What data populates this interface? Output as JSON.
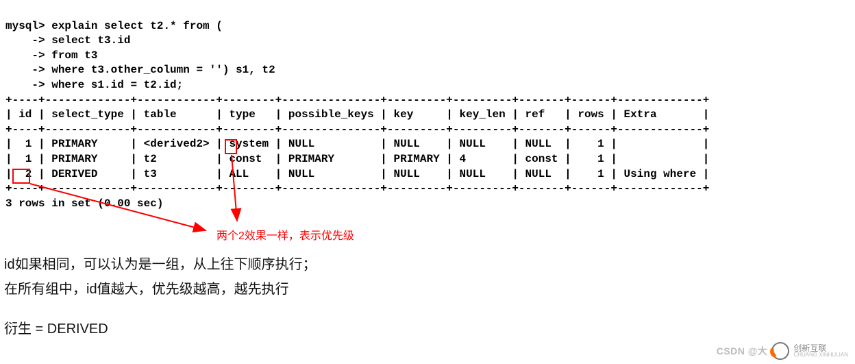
{
  "sql": {
    "prompt": "mysql>",
    "cont": "    ->",
    "lines": [
      "explain select t2.* from (",
      "select t3.id",
      "from t3",
      "where t3.other_column = '') s1, t2",
      "where s1.id = t2.id;"
    ]
  },
  "table": {
    "border": "+----+-------------+------------+--------+---------------+---------+---------+-------+------+-------------+",
    "header": "| id | select_type | table      | type   | possible_keys | key     | key_len | ref   | rows | Extra       |",
    "rows": [
      "|  1 | PRIMARY     | <derived2> | system | NULL          | NULL    | NULL    | NULL  |    1 |             |",
      "|  1 | PRIMARY     | t2         | const  | PRIMARY       | PRIMARY | 4       | const |    1 |             |",
      "|  2 | DERIVED     | t3         | ALL    | NULL          | NULL    | NULL    | NULL  |    1 | Using where |"
    ],
    "footer": "3 rows in set (0.00 sec)"
  },
  "annotation": {
    "text": "两个2效果一样，表示优先级"
  },
  "commentary": {
    "line1": "id如果相同，可以认为是一组，从上往下顺序执行；",
    "line2": "在所有组中，id值越大，优先级越高，越先执行",
    "line3": "衍生 = DERIVED"
  },
  "watermark": {
    "csdn": "CSDN @大",
    "brand": "创新互联"
  },
  "chart_data": {
    "type": "table",
    "title": "MySQL EXPLAIN output",
    "columns": [
      "id",
      "select_type",
      "table",
      "type",
      "possible_keys",
      "key",
      "key_len",
      "ref",
      "rows",
      "Extra"
    ],
    "rows": [
      {
        "id": 1,
        "select_type": "PRIMARY",
        "table": "<derived2>",
        "type": "system",
        "possible_keys": "NULL",
        "key": "NULL",
        "key_len": "NULL",
        "ref": "NULL",
        "rows": 1,
        "Extra": ""
      },
      {
        "id": 1,
        "select_type": "PRIMARY",
        "table": "t2",
        "type": "const",
        "possible_keys": "PRIMARY",
        "key": "PRIMARY",
        "key_len": "4",
        "ref": "const",
        "rows": 1,
        "Extra": ""
      },
      {
        "id": 2,
        "select_type": "DERIVED",
        "table": "t3",
        "type": "ALL",
        "possible_keys": "NULL",
        "key": "NULL",
        "key_len": "NULL",
        "ref": "NULL",
        "rows": 1,
        "Extra": "Using where"
      }
    ],
    "query": "explain select t2.* from ( select t3.id from t3 where t3.other_column = '') s1, t2 where s1.id = t2.id;",
    "result_summary": "3 rows in set (0.00 sec)"
  }
}
